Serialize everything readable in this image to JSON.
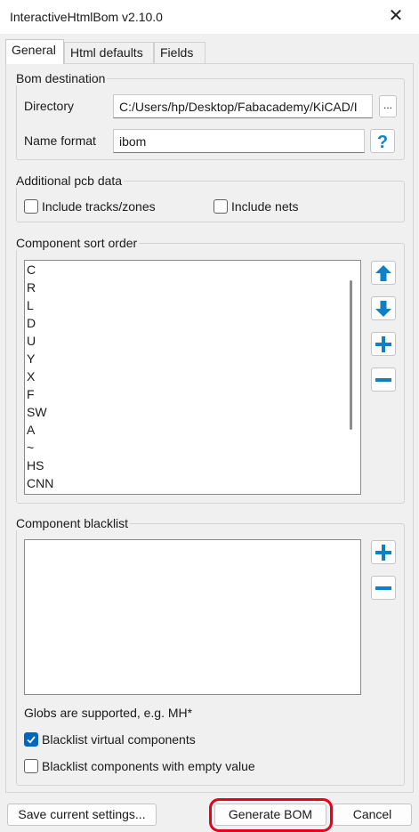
{
  "window": {
    "title": "InteractiveHtmlBom v2.10.0",
    "close_icon": "close-icon"
  },
  "tabs": [
    {
      "label": "General",
      "active": true
    },
    {
      "label": "Html defaults",
      "active": false
    },
    {
      "label": "Fields",
      "active": false
    }
  ],
  "bom_destination": {
    "legend": "Bom destination",
    "directory_label": "Directory",
    "directory_value": "C:/Users/hp/Desktop/Fabacademy/KiCAD/I",
    "browse_label": "...",
    "name_format_label": "Name format",
    "name_format_value": "ibom",
    "help_label": "?"
  },
  "additional_pcb": {
    "legend": "Additional pcb data",
    "include_tracks_label": "Include tracks/zones",
    "include_tracks_checked": false,
    "include_nets_label": "Include nets",
    "include_nets_checked": false
  },
  "sort_order": {
    "legend": "Component sort order",
    "items": [
      "C",
      "R",
      "L",
      "D",
      "U",
      "Y",
      "X",
      "F",
      "SW",
      "A",
      "~",
      "HS",
      "CNN"
    ]
  },
  "blacklist": {
    "legend": "Component blacklist",
    "items": [],
    "globs_note": "Globs are supported, e.g. MH*",
    "virtual_label": "Blacklist virtual components",
    "virtual_checked": true,
    "empty_value_label": "Blacklist components with empty value",
    "empty_value_checked": false
  },
  "buttons": {
    "save_settings": "Save current settings...",
    "generate": "Generate BOM",
    "cancel": "Cancel"
  },
  "colors": {
    "accent_blue": "#0f7fc6",
    "checkbox_blue": "#0067c0",
    "highlight_red": "#e8001c"
  }
}
